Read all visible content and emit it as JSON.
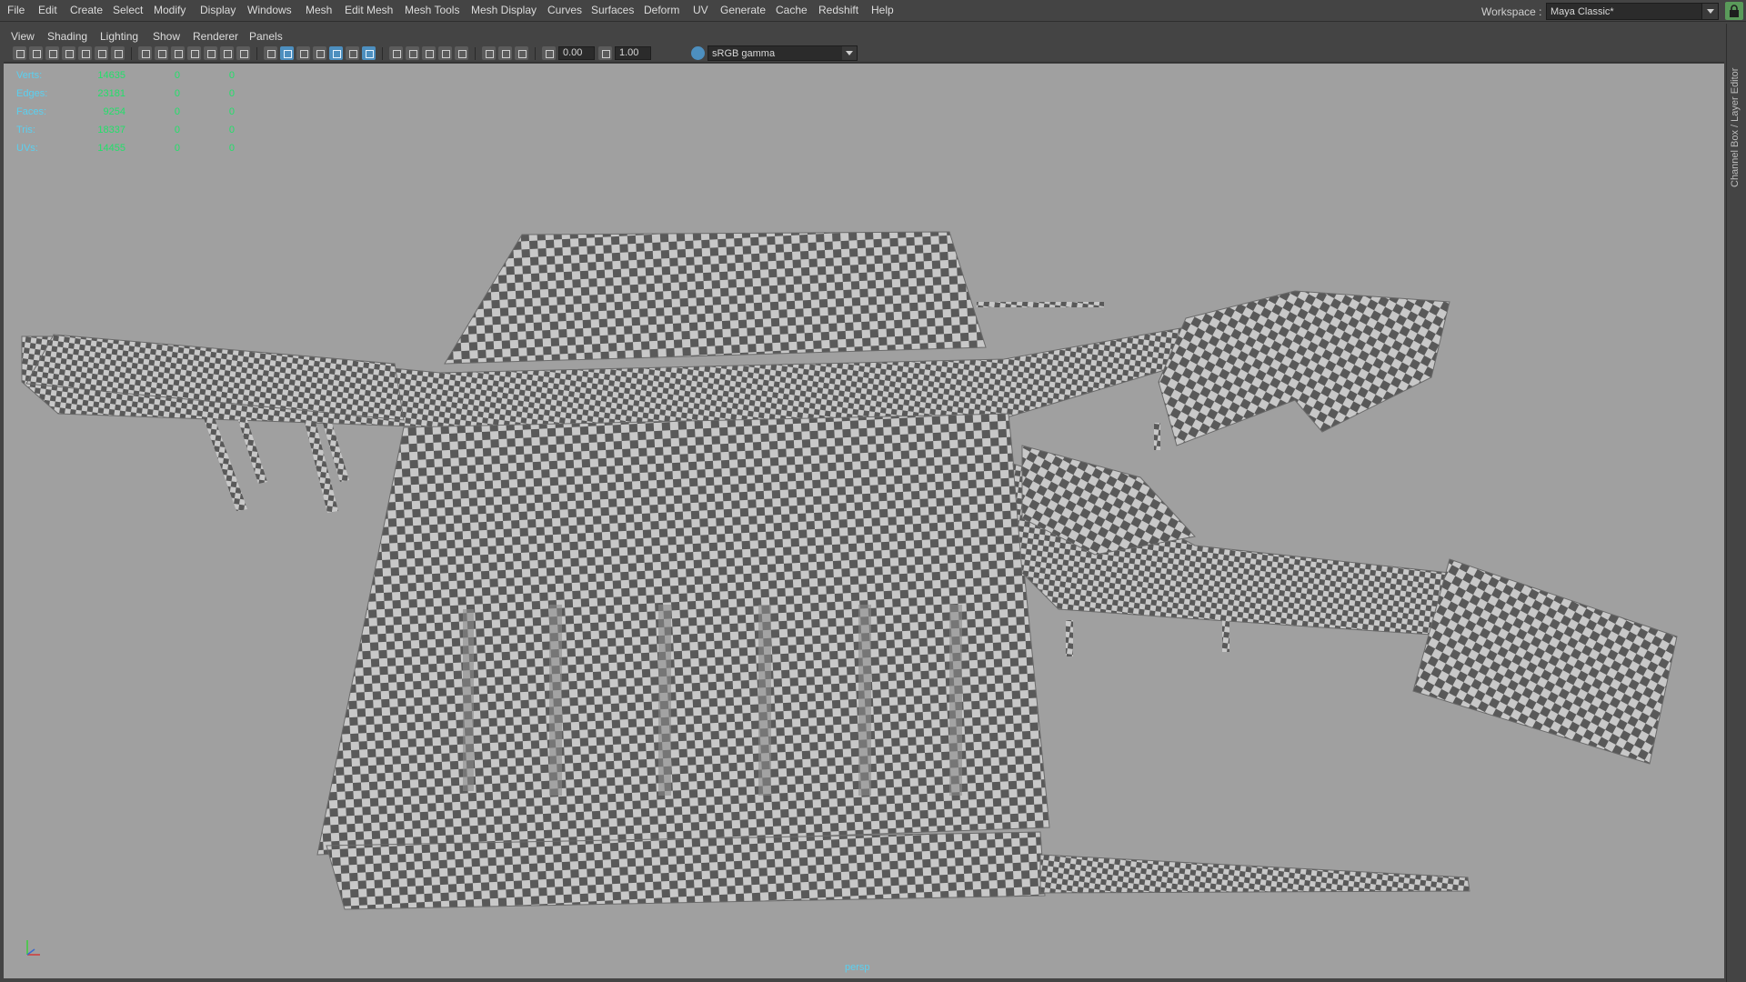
{
  "main_menu": [
    "File",
    "Edit",
    "Create",
    "Select",
    "Modify",
    "Display",
    "Windows",
    "Mesh",
    "Edit Mesh",
    "Mesh Tools",
    "Mesh Display",
    "Curves",
    "Surfaces",
    "Deform",
    "UV",
    "Generate",
    "Cache",
    "Redshift",
    "Help"
  ],
  "workspace": {
    "label": "Workspace :",
    "value": "Maya Classic*"
  },
  "panel_menu": [
    "View",
    "Shading",
    "Lighting",
    "Show",
    "Renderer",
    "Panels"
  ],
  "toolbar": {
    "exposure": "0.00",
    "gamma": "1.00",
    "color_space": "sRGB gamma"
  },
  "hud": {
    "rows": [
      {
        "label": "Verts:",
        "v1": "14635",
        "v2": "0",
        "v3": "0"
      },
      {
        "label": "Edges:",
        "v1": "23181",
        "v2": "0",
        "v3": "0"
      },
      {
        "label": "Faces:",
        "v1": "9254",
        "v2": "0",
        "v3": "0"
      },
      {
        "label": "Tris:",
        "v1": "18337",
        "v2": "0",
        "v3": "0"
      },
      {
        "label": "UVs:",
        "v1": "14455",
        "v2": "0",
        "v3": "0"
      }
    ]
  },
  "camera": "persp",
  "right_dock_tab": "Channel Box / Layer Editor",
  "colors": {
    "viewport_bg": "#a0a0a0",
    "checker_dark": "#595959",
    "checker_light": "#c8c8c8",
    "hud_label": "#5ad0f0",
    "hud_value": "#22e06a"
  }
}
